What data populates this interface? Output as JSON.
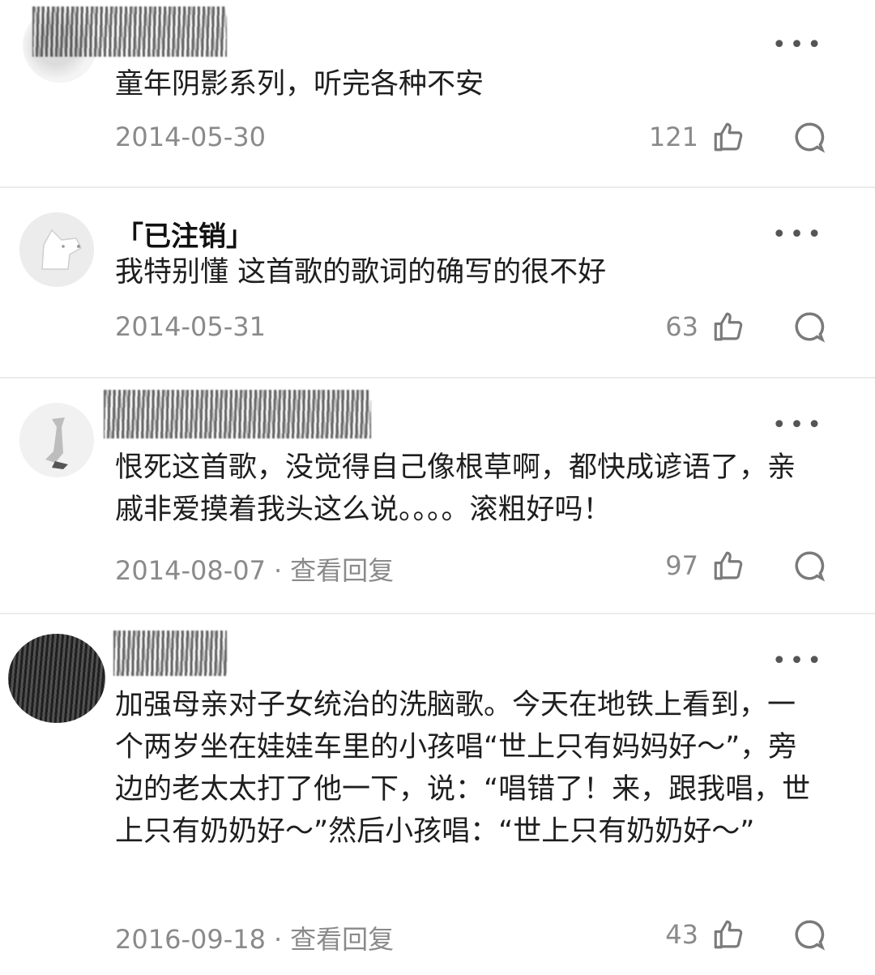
{
  "comments": [
    {
      "username": "",
      "text": "童年阴影系列，听完各种不安",
      "date": "2014-05-30",
      "view_replies": "",
      "likes": "121"
    },
    {
      "username": "「已注销」",
      "text": "我特别懂 这首歌的歌词的确写的很不好",
      "date": "2014-05-31",
      "view_replies": "",
      "likes": "63"
    },
    {
      "username": "",
      "text": "恨死这首歌，没觉得自己像根草啊，都快成谚语了，亲戚非爱摸着我头这么说。。。。滚粗好吗！",
      "date": "2014-08-07",
      "view_replies": "查看回复",
      "likes": "97"
    },
    {
      "username": "",
      "text": "加强母亲对子女统治的洗脑歌。今天在地铁上看到，一个两岁坐在娃娃车里的小孩唱“世上只有妈妈好～”，旁边的老太太打了他一下，说：“唱错了！来，跟我唱，世上只有奶奶好～”然后小孩唱：“世上只有奶奶好～”",
      "date": "2016-09-18",
      "view_replies": "查看回复",
      "likes": "43"
    }
  ],
  "ui": {
    "more_glyph": "•••",
    "dot_sep": "·"
  },
  "icons": {
    "like": "thumbs-up-icon",
    "reply": "comment-bubble-icon",
    "more": "more-dots-icon"
  }
}
